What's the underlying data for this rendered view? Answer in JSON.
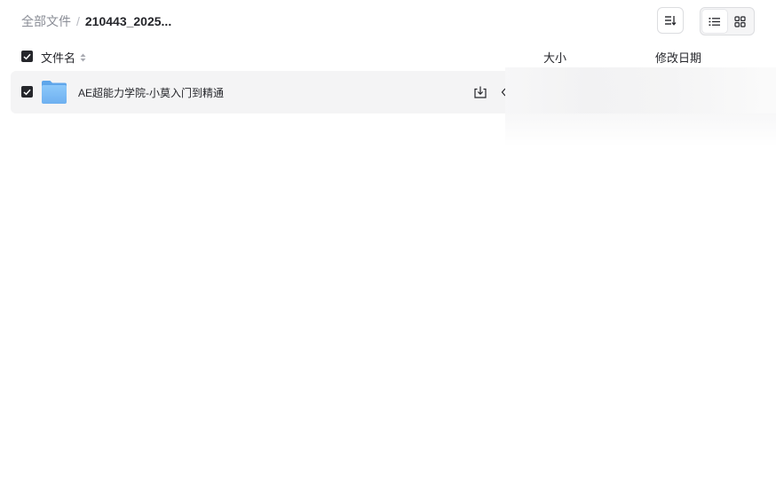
{
  "breadcrumb": {
    "root": "全部文件",
    "separator": "/",
    "current": "210443_2025..."
  },
  "toolbar": {
    "sort_icon": "sort-lines-icon",
    "view_modes": [
      {
        "name": "list",
        "icon": "list-icon",
        "active": true
      },
      {
        "name": "grid",
        "icon": "grid-icon",
        "active": false
      }
    ]
  },
  "table": {
    "columns": {
      "name": "文件名",
      "size": "大小",
      "modified": "修改日期"
    },
    "rows": [
      {
        "type": "folder",
        "icon": "folder-icon",
        "name": "AE超能力学院-小莫入门到精通",
        "checked": true
      }
    ]
  },
  "colors": {
    "accent": "#25262b",
    "row_selected_bg": "#f4f4f5",
    "folder_blue": "#7dbbf5"
  }
}
